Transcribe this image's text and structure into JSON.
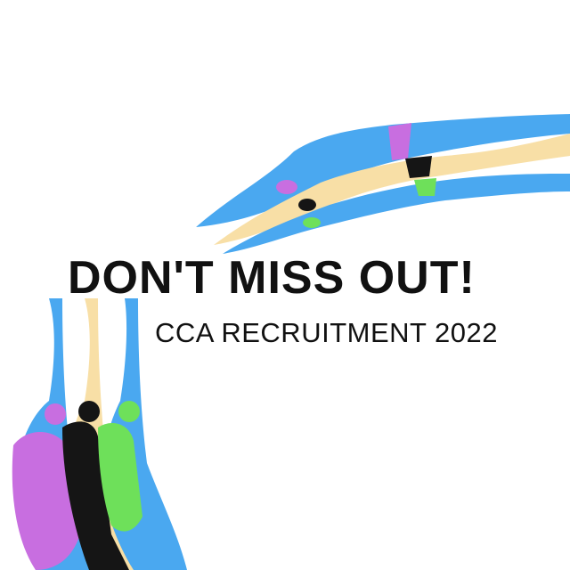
{
  "headline": "DON'T MISS OUT!",
  "subheadline": "CCA RECRUITMENT 2022",
  "colors": {
    "blue": "#4aa8f0",
    "skin": "#f8dfa6",
    "pink": "#c86ee0",
    "green": "#6ee05a",
    "black": "#151515"
  }
}
